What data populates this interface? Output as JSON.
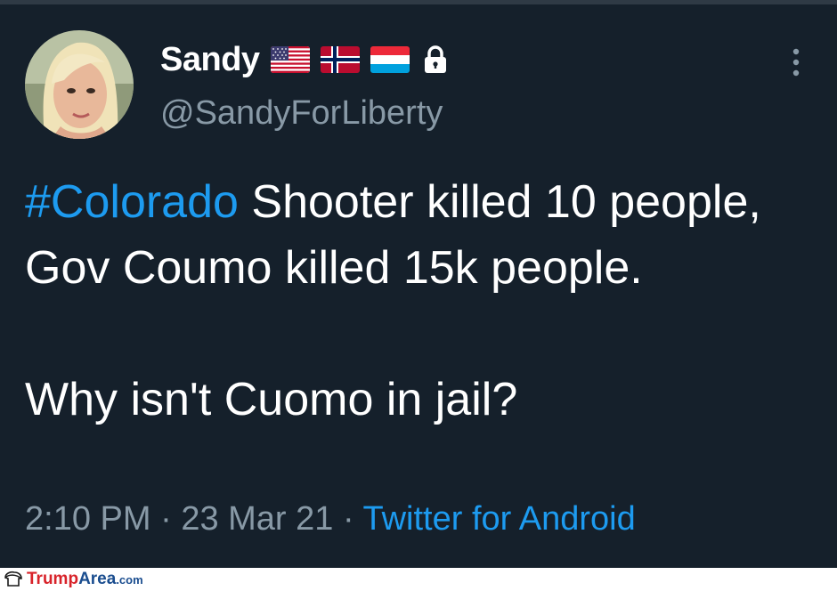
{
  "user": {
    "display_name": "Sandy",
    "handle": "@SandyForLiberty",
    "flags": [
      "us-flag-icon",
      "norway-flag-icon",
      "luxembourg-flag-icon"
    ],
    "protected_icon": "lock-icon"
  },
  "tweet": {
    "hashtag": "#Colorado",
    "text_line1": " Shooter killed 10 people, Gov Coumo killed 15k people.",
    "text_line2": "Why isn't Cuomo in jail?",
    "time": "2:10 PM",
    "date": "23 Mar 21",
    "separator": " · ",
    "source": "Twitter for Android"
  },
  "menu": {
    "icon": "more-vertical-icon"
  },
  "watermark": {
    "part1": "Trump",
    "part2": "Area",
    "part3": ".com"
  },
  "colors": {
    "background": "#15202b",
    "accent": "#1d9bf0",
    "secondary_text": "#8899a6"
  }
}
